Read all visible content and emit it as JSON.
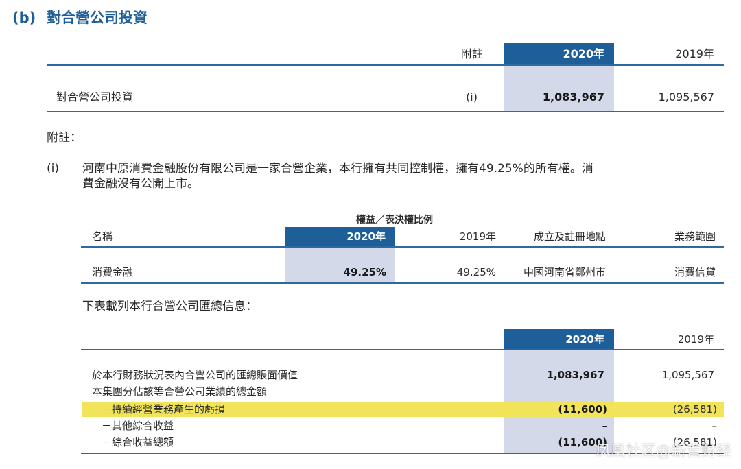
{
  "section": {
    "label": "(b)",
    "title": "對合營公司投資"
  },
  "table1": {
    "headers": {
      "note": "附註",
      "y2020": "2020年",
      "y2019": "2019年"
    },
    "row": {
      "label": "對合營公司投資",
      "note": "(i)",
      "v2020": "1,083,967",
      "v2019": "1,095,567"
    }
  },
  "notes": {
    "title": "附註：",
    "items": [
      {
        "marker": "(i)",
        "line1": "河南中原消費金融股份有限公司是一家合營企業，本行擁有共同控制權，擁有49.25%的所有權。消",
        "line2": "費金融沒有公開上市。"
      }
    ]
  },
  "table2": {
    "group_header": "權益／表決權比例",
    "headers": {
      "name": "名稱",
      "y2020": "2020年",
      "y2019": "2019年",
      "place": "成立及註冊地點",
      "business": "業務範圍"
    },
    "row": {
      "name": "消費金融",
      "v2020": "49.25%",
      "v2019": "49.25%",
      "place": "中國河南省鄭州市",
      "business": "消費信貸"
    }
  },
  "summary_intro": "下表載列本行合營公司匯總信息：",
  "table3": {
    "headers": {
      "y2020": "2020年",
      "y2019": "2019年"
    },
    "rows": [
      {
        "label": "於本行財務狀況表內合營公司的匯總賬面價值",
        "v2020": "1,083,967",
        "v2019": "1,095,567"
      },
      {
        "label": "本集團分佔該等合營公司業績的總金額",
        "v2020": "",
        "v2019": ""
      },
      {
        "label": "－持續經營業務產生的虧損",
        "v2020": "(11,600)",
        "v2019": "(26,581)"
      },
      {
        "label": "－其他綜合收益",
        "v2020": "–",
        "v2019": "–"
      },
      {
        "label": "－綜合收益總額",
        "v2020": "(11,600)",
        "v2019": "(26,581)"
      }
    ]
  },
  "watermark": "凤凰社区@新营财经",
  "colors": {
    "brand": "#1f5f99",
    "shade": "#d3d9e8",
    "highlight": "#f1e35a"
  }
}
